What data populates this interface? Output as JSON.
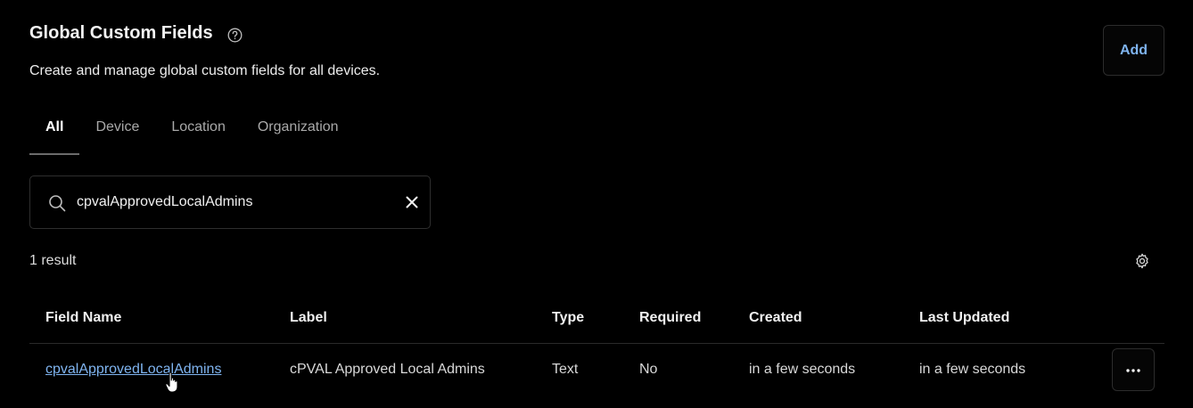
{
  "header": {
    "title": "Global Custom Fields",
    "subtitle": "Create and manage global custom fields for all devices.",
    "help_icon": "question-circle-icon",
    "add_label": "Add"
  },
  "tabs": [
    {
      "label": "All",
      "active": true
    },
    {
      "label": "Device",
      "active": false
    },
    {
      "label": "Location",
      "active": false
    },
    {
      "label": "Organization",
      "active": false
    }
  ],
  "search": {
    "value": "cpvalApprovedLocalAdmins",
    "icon": "search-icon",
    "clear_icon": "close-icon"
  },
  "results": {
    "count_label": "1 result",
    "settings_icon": "gear-icon"
  },
  "table": {
    "columns": [
      "Field Name",
      "Label",
      "Type",
      "Required",
      "Created",
      "Last Updated"
    ],
    "rows": [
      {
        "field_name": "cpvalApprovedLocalAdmins",
        "label": "cPVAL Approved Local Admins",
        "type": "Text",
        "required": "No",
        "created": "in a few seconds",
        "last_updated": "in a few seconds",
        "actions_icon": "more-horizontal-icon"
      }
    ]
  },
  "colors": {
    "background": "#000000",
    "accent_link": "#7fb4f0",
    "border": "#2c2c2c"
  }
}
